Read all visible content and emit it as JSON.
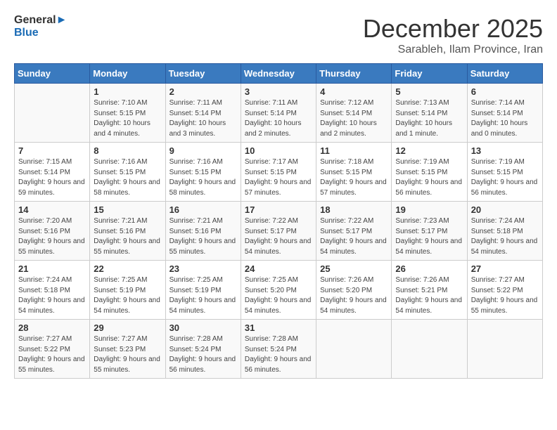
{
  "logo": {
    "line1": "General",
    "line2": "Blue"
  },
  "title": "December 2025",
  "subtitle": "Sarableh, Ilam Province, Iran",
  "weekdays": [
    "Sunday",
    "Monday",
    "Tuesday",
    "Wednesday",
    "Thursday",
    "Friday",
    "Saturday"
  ],
  "weeks": [
    [
      {
        "day": "",
        "sunrise": "",
        "sunset": "",
        "daylight": ""
      },
      {
        "day": "1",
        "sunrise": "Sunrise: 7:10 AM",
        "sunset": "Sunset: 5:15 PM",
        "daylight": "Daylight: 10 hours and 4 minutes."
      },
      {
        "day": "2",
        "sunrise": "Sunrise: 7:11 AM",
        "sunset": "Sunset: 5:14 PM",
        "daylight": "Daylight: 10 hours and 3 minutes."
      },
      {
        "day": "3",
        "sunrise": "Sunrise: 7:11 AM",
        "sunset": "Sunset: 5:14 PM",
        "daylight": "Daylight: 10 hours and 2 minutes."
      },
      {
        "day": "4",
        "sunrise": "Sunrise: 7:12 AM",
        "sunset": "Sunset: 5:14 PM",
        "daylight": "Daylight: 10 hours and 2 minutes."
      },
      {
        "day": "5",
        "sunrise": "Sunrise: 7:13 AM",
        "sunset": "Sunset: 5:14 PM",
        "daylight": "Daylight: 10 hours and 1 minute."
      },
      {
        "day": "6",
        "sunrise": "Sunrise: 7:14 AM",
        "sunset": "Sunset: 5:14 PM",
        "daylight": "Daylight: 10 hours and 0 minutes."
      }
    ],
    [
      {
        "day": "7",
        "sunrise": "Sunrise: 7:15 AM",
        "sunset": "Sunset: 5:14 PM",
        "daylight": "Daylight: 9 hours and 59 minutes."
      },
      {
        "day": "8",
        "sunrise": "Sunrise: 7:16 AM",
        "sunset": "Sunset: 5:15 PM",
        "daylight": "Daylight: 9 hours and 58 minutes."
      },
      {
        "day": "9",
        "sunrise": "Sunrise: 7:16 AM",
        "sunset": "Sunset: 5:15 PM",
        "daylight": "Daylight: 9 hours and 58 minutes."
      },
      {
        "day": "10",
        "sunrise": "Sunrise: 7:17 AM",
        "sunset": "Sunset: 5:15 PM",
        "daylight": "Daylight: 9 hours and 57 minutes."
      },
      {
        "day": "11",
        "sunrise": "Sunrise: 7:18 AM",
        "sunset": "Sunset: 5:15 PM",
        "daylight": "Daylight: 9 hours and 57 minutes."
      },
      {
        "day": "12",
        "sunrise": "Sunrise: 7:19 AM",
        "sunset": "Sunset: 5:15 PM",
        "daylight": "Daylight: 9 hours and 56 minutes."
      },
      {
        "day": "13",
        "sunrise": "Sunrise: 7:19 AM",
        "sunset": "Sunset: 5:15 PM",
        "daylight": "Daylight: 9 hours and 56 minutes."
      }
    ],
    [
      {
        "day": "14",
        "sunrise": "Sunrise: 7:20 AM",
        "sunset": "Sunset: 5:16 PM",
        "daylight": "Daylight: 9 hours and 55 minutes."
      },
      {
        "day": "15",
        "sunrise": "Sunrise: 7:21 AM",
        "sunset": "Sunset: 5:16 PM",
        "daylight": "Daylight: 9 hours and 55 minutes."
      },
      {
        "day": "16",
        "sunrise": "Sunrise: 7:21 AM",
        "sunset": "Sunset: 5:16 PM",
        "daylight": "Daylight: 9 hours and 55 minutes."
      },
      {
        "day": "17",
        "sunrise": "Sunrise: 7:22 AM",
        "sunset": "Sunset: 5:17 PM",
        "daylight": "Daylight: 9 hours and 54 minutes."
      },
      {
        "day": "18",
        "sunrise": "Sunrise: 7:22 AM",
        "sunset": "Sunset: 5:17 PM",
        "daylight": "Daylight: 9 hours and 54 minutes."
      },
      {
        "day": "19",
        "sunrise": "Sunrise: 7:23 AM",
        "sunset": "Sunset: 5:17 PM",
        "daylight": "Daylight: 9 hours and 54 minutes."
      },
      {
        "day": "20",
        "sunrise": "Sunrise: 7:24 AM",
        "sunset": "Sunset: 5:18 PM",
        "daylight": "Daylight: 9 hours and 54 minutes."
      }
    ],
    [
      {
        "day": "21",
        "sunrise": "Sunrise: 7:24 AM",
        "sunset": "Sunset: 5:18 PM",
        "daylight": "Daylight: 9 hours and 54 minutes."
      },
      {
        "day": "22",
        "sunrise": "Sunrise: 7:25 AM",
        "sunset": "Sunset: 5:19 PM",
        "daylight": "Daylight: 9 hours and 54 minutes."
      },
      {
        "day": "23",
        "sunrise": "Sunrise: 7:25 AM",
        "sunset": "Sunset: 5:19 PM",
        "daylight": "Daylight: 9 hours and 54 minutes."
      },
      {
        "day": "24",
        "sunrise": "Sunrise: 7:25 AM",
        "sunset": "Sunset: 5:20 PM",
        "daylight": "Daylight: 9 hours and 54 minutes."
      },
      {
        "day": "25",
        "sunrise": "Sunrise: 7:26 AM",
        "sunset": "Sunset: 5:20 PM",
        "daylight": "Daylight: 9 hours and 54 minutes."
      },
      {
        "day": "26",
        "sunrise": "Sunrise: 7:26 AM",
        "sunset": "Sunset: 5:21 PM",
        "daylight": "Daylight: 9 hours and 54 minutes."
      },
      {
        "day": "27",
        "sunrise": "Sunrise: 7:27 AM",
        "sunset": "Sunset: 5:22 PM",
        "daylight": "Daylight: 9 hours and 55 minutes."
      }
    ],
    [
      {
        "day": "28",
        "sunrise": "Sunrise: 7:27 AM",
        "sunset": "Sunset: 5:22 PM",
        "daylight": "Daylight: 9 hours and 55 minutes."
      },
      {
        "day": "29",
        "sunrise": "Sunrise: 7:27 AM",
        "sunset": "Sunset: 5:23 PM",
        "daylight": "Daylight: 9 hours and 55 minutes."
      },
      {
        "day": "30",
        "sunrise": "Sunrise: 7:28 AM",
        "sunset": "Sunset: 5:24 PM",
        "daylight": "Daylight: 9 hours and 56 minutes."
      },
      {
        "day": "31",
        "sunrise": "Sunrise: 7:28 AM",
        "sunset": "Sunset: 5:24 PM",
        "daylight": "Daylight: 9 hours and 56 minutes."
      },
      {
        "day": "",
        "sunrise": "",
        "sunset": "",
        "daylight": ""
      },
      {
        "day": "",
        "sunrise": "",
        "sunset": "",
        "daylight": ""
      },
      {
        "day": "",
        "sunrise": "",
        "sunset": "",
        "daylight": ""
      }
    ]
  ]
}
